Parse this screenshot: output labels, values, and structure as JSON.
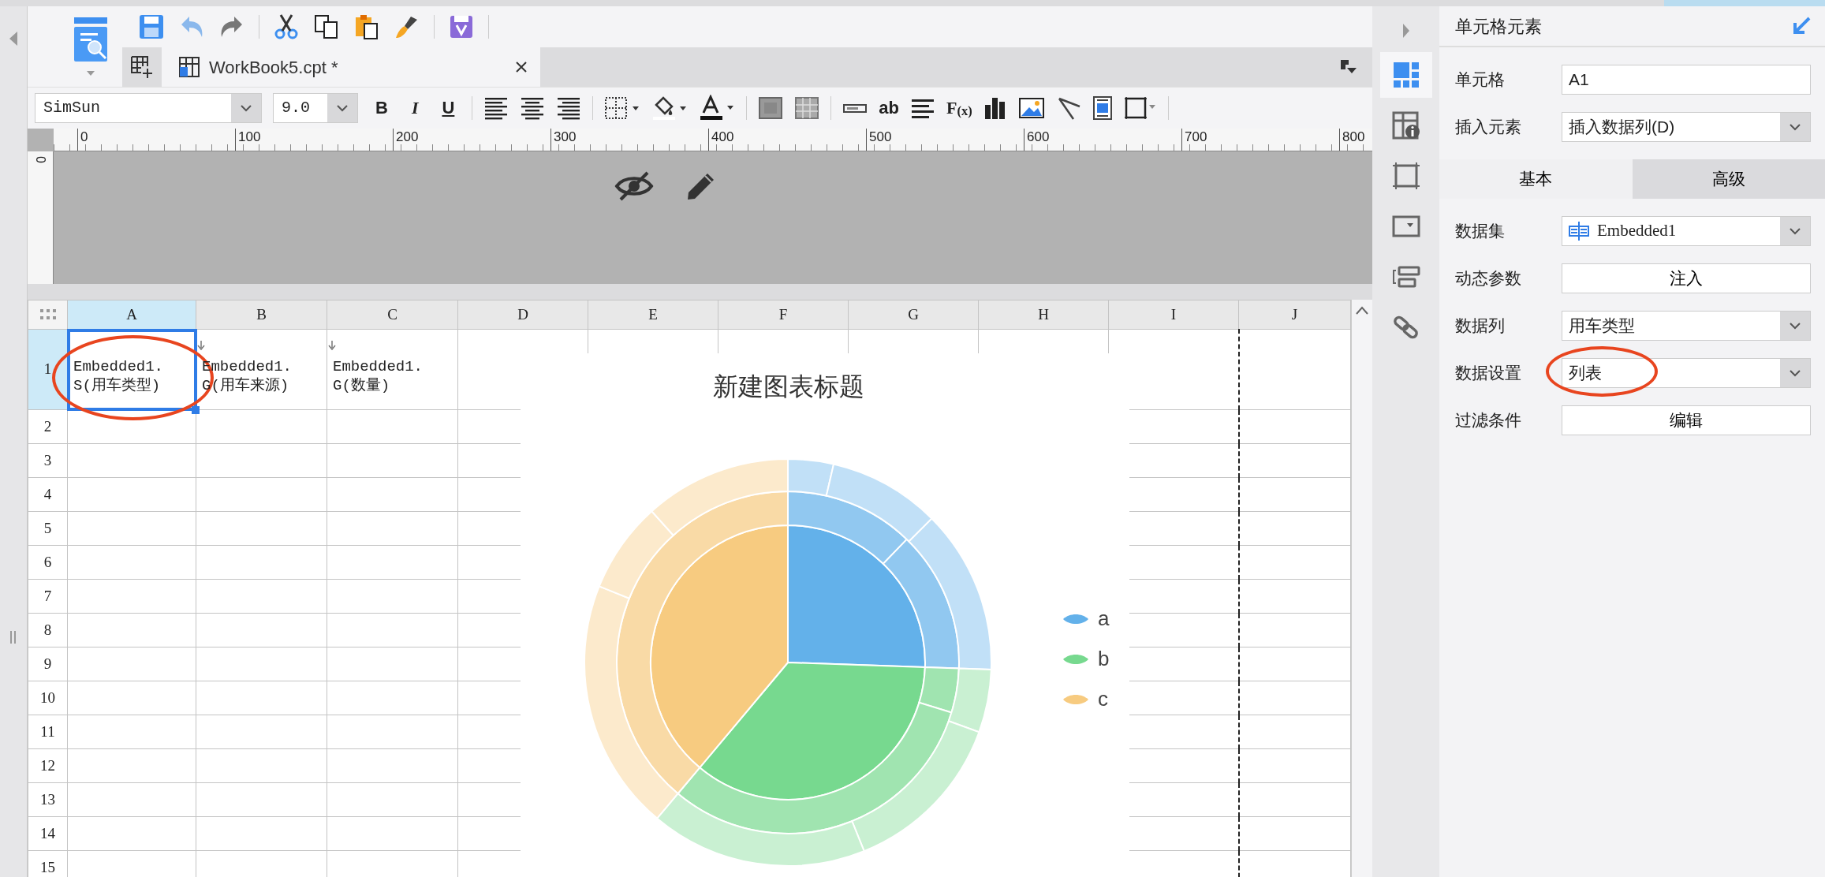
{
  "document_tabs": [
    {
      "label": "WorkBook5.cpt *",
      "selected": true
    }
  ],
  "format_toolbar": {
    "font": "SimSun",
    "size": "9.0",
    "style_buttons": [
      "B",
      "I",
      "U"
    ],
    "text_tools": [
      "ab",
      "F$_{(x)}$"
    ]
  },
  "ruler": {
    "horizontal": [
      "0",
      "100",
      "200",
      "300",
      "400",
      "500",
      "600",
      "700",
      "800"
    ],
    "vertical": [
      "0"
    ]
  },
  "sheet": {
    "columns": [
      {
        "label": "A",
        "selected": true
      },
      {
        "label": "B",
        "selected": false
      },
      {
        "label": "C",
        "selected": false
      },
      {
        "label": "D",
        "selected": false
      },
      {
        "label": "E",
        "selected": false
      },
      {
        "label": "F",
        "selected": false
      },
      {
        "label": "G",
        "selected": false
      },
      {
        "label": "H",
        "selected": false
      },
      {
        "label": "I",
        "selected": false
      },
      {
        "label": "J",
        "selected": false
      }
    ],
    "rows": [
      {
        "label": "1",
        "selected": true,
        "cells": [
          {
            "lines": [
              "Embedded1.",
              "S(用车类型)"
            ],
            "selected": true,
            "circled": true,
            "expand_marker": false
          },
          {
            "lines": [
              "Embedded1.",
              "G(用车来源)"
            ],
            "selected": false,
            "circled": false,
            "expand_marker": true
          },
          {
            "lines": [
              "Embedded1.",
              "G(数量)"
            ],
            "selected": false,
            "circled": false,
            "expand_marker": true
          }
        ]
      },
      {
        "label": "2",
        "selected": false
      },
      {
        "label": "3",
        "selected": false
      },
      {
        "label": "4",
        "selected": false
      },
      {
        "label": "5",
        "selected": false
      },
      {
        "label": "6",
        "selected": false
      },
      {
        "label": "7",
        "selected": false
      },
      {
        "label": "8",
        "selected": false
      },
      {
        "label": "9",
        "selected": false
      },
      {
        "label": "10",
        "selected": false
      },
      {
        "label": "11",
        "selected": false
      },
      {
        "label": "12",
        "selected": false
      },
      {
        "label": "13",
        "selected": false
      },
      {
        "label": "14",
        "selected": false
      },
      {
        "label": "15",
        "selected": false
      }
    ]
  },
  "chart": {
    "title": "新建图表标题",
    "legend": [
      {
        "label": "a",
        "color": "#63b1ea"
      },
      {
        "label": "b",
        "color": "#77d98f"
      },
      {
        "label": "c",
        "color": "#f7cb80"
      }
    ]
  },
  "side_icons": [
    {
      "selected": true
    },
    {
      "selected": false
    },
    {
      "selected": false
    },
    {
      "selected": false
    },
    {
      "selected": false
    },
    {
      "selected": false
    }
  ],
  "properties": {
    "title": "单元格元素",
    "fields": [
      {
        "kind": "text",
        "label": "单元格",
        "value": "A1",
        "circled": false
      },
      {
        "kind": "select",
        "label": "插入元素",
        "value": "插入数据列(D)",
        "circled": false
      }
    ],
    "tabs": [
      {
        "label": "基本",
        "selected": true
      },
      {
        "label": "高级",
        "selected": false
      }
    ],
    "tab_fields": [
      {
        "kind": "dataset",
        "label": "数据集",
        "value": "Embedded1",
        "circled": false
      },
      {
        "kind": "button",
        "label": "动态参数",
        "value": "注入",
        "circled": false
      },
      {
        "kind": "select",
        "label": "数据列",
        "value": "用车类型",
        "circled": false
      },
      {
        "kind": "select",
        "label": "数据设置",
        "value": "列表",
        "circled": true
      },
      {
        "kind": "button",
        "label": "过滤条件",
        "value": "编辑",
        "circled": false
      }
    ]
  }
}
